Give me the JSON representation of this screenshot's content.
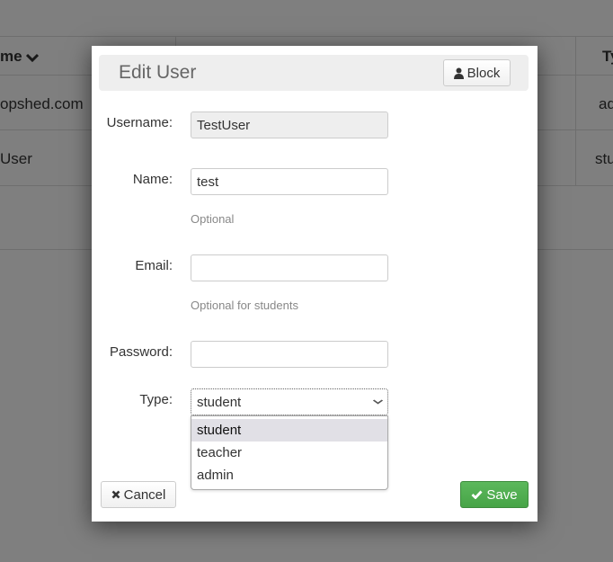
{
  "background_page": {
    "table": {
      "header": {
        "col1": "me",
        "col1_sort_icon": "chevron-down-icon",
        "col3": "Ty"
      },
      "rows": [
        {
          "col1": "opshed.com",
          "col3": "ad"
        },
        {
          "col1": "User",
          "col3": "stu"
        }
      ]
    }
  },
  "modal": {
    "title": "Edit User",
    "block_button": {
      "label": "Block",
      "icon": "user-icon"
    },
    "fields": {
      "username": {
        "label": "Username:",
        "value": "TestUser",
        "readonly": true
      },
      "name": {
        "label": "Name:",
        "value": "test",
        "help": "Optional"
      },
      "email": {
        "label": "Email:",
        "value": "",
        "help": "Optional for students"
      },
      "password": {
        "label": "Password:",
        "value": ""
      },
      "type": {
        "label": "Type:",
        "value": "student",
        "options": [
          "student",
          "teacher",
          "admin"
        ],
        "highlighted": "student"
      }
    },
    "cancel_button": {
      "label": "Cancel",
      "icon": "close-icon"
    },
    "save_button": {
      "label": "Save",
      "icon": "check-icon",
      "color": "#4cae4c"
    }
  }
}
